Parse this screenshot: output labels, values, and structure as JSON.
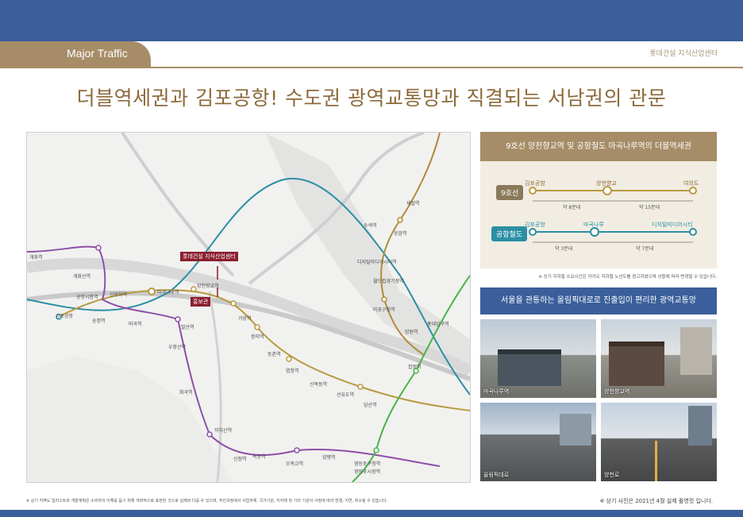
{
  "header": {
    "section": "Major Traffic",
    "brand": "롯데건설 지식산업센터"
  },
  "headline": "더블역세권과 김포공항! 수도권 광역교통망과 직결되는 서남권의 관문",
  "map": {
    "site_label": "롯데건설 지식산업센터",
    "showroom_label": "홍보관",
    "stations": [
      "개화역",
      "개화산역",
      "김포공항",
      "송정역",
      "마곡역",
      "공항시장역",
      "신방화역",
      "마곡나루역",
      "양천향교역",
      "가양역",
      "증미역",
      "등촌역",
      "염창역",
      "신목동역",
      "선유도역",
      "당산역",
      "발산역",
      "우장산역",
      "화곡역",
      "까치산역",
      "신정역",
      "목동역",
      "오목교역",
      "양평역",
      "영등포구청역",
      "영등포시장역",
      "디지털미디어시티역",
      "월드컵경기장역",
      "마포구청역",
      "망원역",
      "합정역",
      "홍대입구역",
      "수색역",
      "새절역",
      "응암역"
    ]
  },
  "commute": {
    "title": "9호선 양천향교역 및 공항철도 마곡나루역의 더블역세권",
    "line9": {
      "tag": "9호선",
      "stations": [
        "김포공항",
        "양천향교",
        "여의도"
      ],
      "times": [
        "약 8분대",
        "약 15분대"
      ]
    },
    "arex": {
      "tag": "공항철도",
      "stations": [
        "김포공항",
        "마곡나루",
        "디지털미디어시티"
      ],
      "times": [
        "약 3분대",
        "약 7분대"
      ]
    },
    "note": "※ 상기 지하철 소요시간은 카카오 지하철 노선도를 참고하였으며 상황에 따라 변경될 수 있습니다."
  },
  "gallery": {
    "title": "서울을 관통하는 올림픽대로로 진출입이 편리한 광역교통망",
    "photos": [
      "마곡나루역",
      "양천향교역",
      "올림픽대로",
      "양천로"
    ]
  },
  "disclaimer_left": "※ 상기 지역도 일러스트와 개발계획은 소비자의 이해를 돕기 위해 개략적으로 표현한 것으로 실제와 다를 수 있으며, 추진과정에서 사업주체, 국가기관, 지자체 및 기타 기관의 사정에 따라 변경, 지연, 취소될 수 있습니다.",
  "disclaimer_right": "※ 상기 사진은 2021년 4월 실제 촬영컷 입니다.",
  "colors": {
    "navy": "#3a5f9b",
    "tan": "#a68d67",
    "line9": "#b99a3f",
    "line5": "#8e4fa7",
    "arex": "#2b8fa3",
    "line6": "#a5802f",
    "line2": "#4ab34a"
  }
}
